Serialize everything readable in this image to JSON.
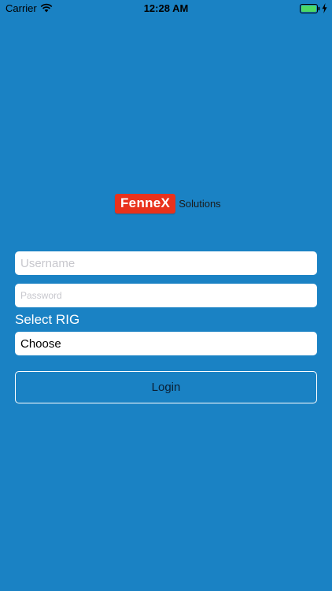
{
  "status_bar": {
    "carrier": "Carrier",
    "time": "12:28 AM",
    "icons": [
      "wifi-icon",
      "battery-icon",
      "charging-bolt-icon"
    ]
  },
  "logo": {
    "brand": "FenneX",
    "suffix": "Solutions",
    "brand_color": "#e9321c"
  },
  "form": {
    "username_placeholder": "Username",
    "password_placeholder": "Password",
    "rig_label": "Select RIG",
    "rig_value": "Choose",
    "login_label": "Login"
  },
  "colors": {
    "background": "#1a82c4",
    "input_background": "#ffffff",
    "battery_fill": "#4cd964"
  }
}
